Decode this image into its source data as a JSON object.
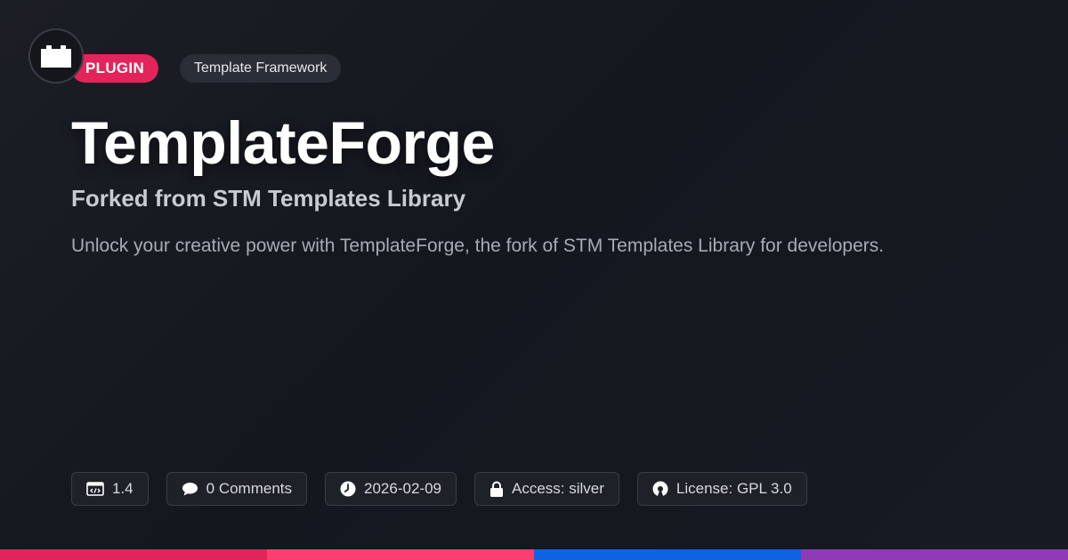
{
  "header": {
    "badge_type": "PLUGIN",
    "badge_category": "Template Framework"
  },
  "main": {
    "title": "TemplateForge",
    "subtitle": "Forked from STM Templates Library",
    "description": "Unlock your creative power with TemplateForge, the fork of STM Templates Library for developers."
  },
  "meta": {
    "version": "1.4",
    "comments": "0 Comments",
    "date": "2026-02-09",
    "access": "Access: silver",
    "license": "License: GPL 3.0"
  },
  "icons": {
    "avatar": "plugin-block-icon",
    "version": "code-window-icon",
    "comments": "speech-bubble-icon",
    "date": "clock-icon",
    "access": "lock-icon",
    "license": "open-source-icon"
  },
  "colors": {
    "accent": "#e3245a",
    "background": "#16181f",
    "bar": [
      "#e3245a",
      "#ff3d6e",
      "#0f63e0",
      "#8e3bb5"
    ]
  }
}
